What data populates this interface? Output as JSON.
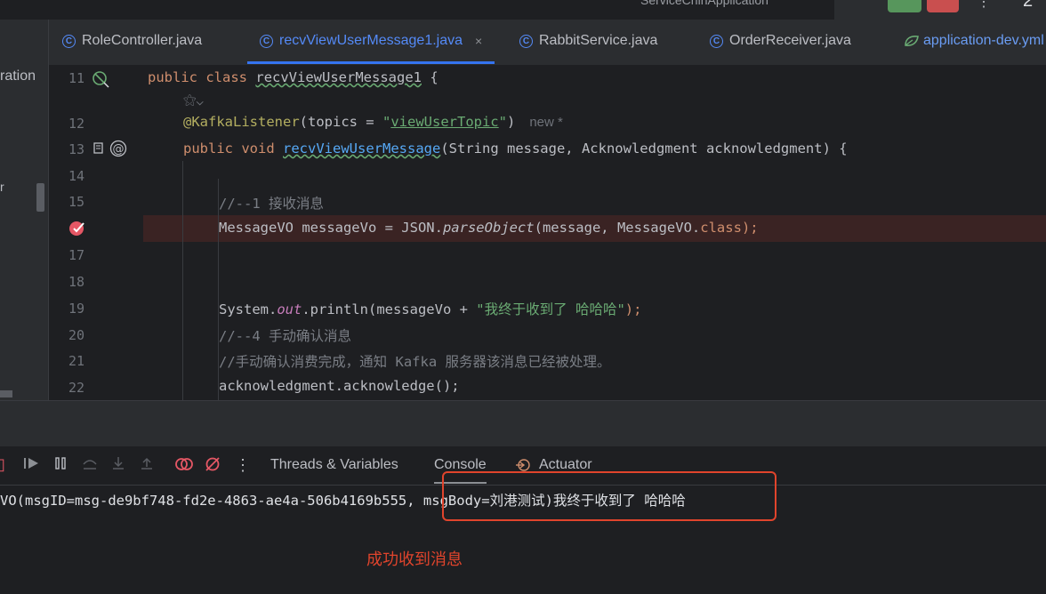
{
  "topbar": {
    "run_config": "ServiceChinApplication",
    "kebab": "⋮",
    "time": "2"
  },
  "tabs": [
    {
      "label": "RoleController.java",
      "icon": "C"
    },
    {
      "label": "recvViewUserMessage1.java",
      "icon": "C",
      "active": true,
      "close": "×"
    },
    {
      "label": "RabbitService.java",
      "icon": "C"
    },
    {
      "label": "OrderReceiver.java",
      "icon": "C"
    },
    {
      "label": "application-dev.yml",
      "icon": "leaf"
    }
  ],
  "project_panel": {
    "fragment_top": "ration",
    "fragment_mid": "r"
  },
  "editor": {
    "lines": [
      {
        "num": "11",
        "parts": [
          "public",
          " ",
          "class",
          " ",
          "recvViewUserMessage1",
          " {"
        ]
      },
      {
        "num": "",
        "hint": "⚝⌄"
      },
      {
        "num": "12",
        "parts": [
          "@KafkaListener",
          "(topics = ",
          "\"",
          "viewUserTopic",
          "\"",
          ")"
        ],
        "hint": "new *"
      },
      {
        "num": "13",
        "parts": [
          "public",
          " ",
          "void",
          " ",
          "recvViewUserMessage",
          "(String message, Acknowledgment acknowledgment) {"
        ]
      },
      {
        "num": "14",
        "parts": []
      },
      {
        "num": "15",
        "parts": [
          "//--1 接收消息"
        ]
      },
      {
        "num": "",
        "parts": [
          "MessageVO messageVo = JSON.",
          "parseObject",
          "(message, MessageVO.",
          "class",
          ");"
        ]
      },
      {
        "num": "17",
        "parts": []
      },
      {
        "num": "18",
        "parts": []
      },
      {
        "num": "19",
        "parts": [
          "System.",
          "out",
          ".println(messageVo + ",
          "\"我终于收到了 哈哈哈\"",
          ");"
        ]
      },
      {
        "num": "20",
        "parts": [
          "//--4 手动确认消息"
        ]
      },
      {
        "num": "21",
        "parts": [
          "//手动确认消费完成，通知 Kafka 服务器该消息已经被处理。"
        ]
      },
      {
        "num": "22",
        "parts": [
          "acknowledgment.acknowledge();"
        ]
      }
    ]
  },
  "debug_toolbar": {
    "tabs": [
      "Threads & Variables",
      "Console",
      "Actuator"
    ],
    "active_tab": "Console"
  },
  "console": {
    "output": "VO(msgID=msg-de9bf748-fd2e-4863-ae4a-506b4169b555, msgBody=刘港测试)我终于收到了 哈哈哈"
  },
  "annotation": {
    "caption": "成功收到消息",
    "box_color": "#e0442c"
  },
  "colors": {
    "accent": "#3574f0",
    "keyword": "#cf8e6d",
    "annotation": "#b3ae60",
    "string": "#6aab73",
    "comment": "#7a7e85"
  }
}
